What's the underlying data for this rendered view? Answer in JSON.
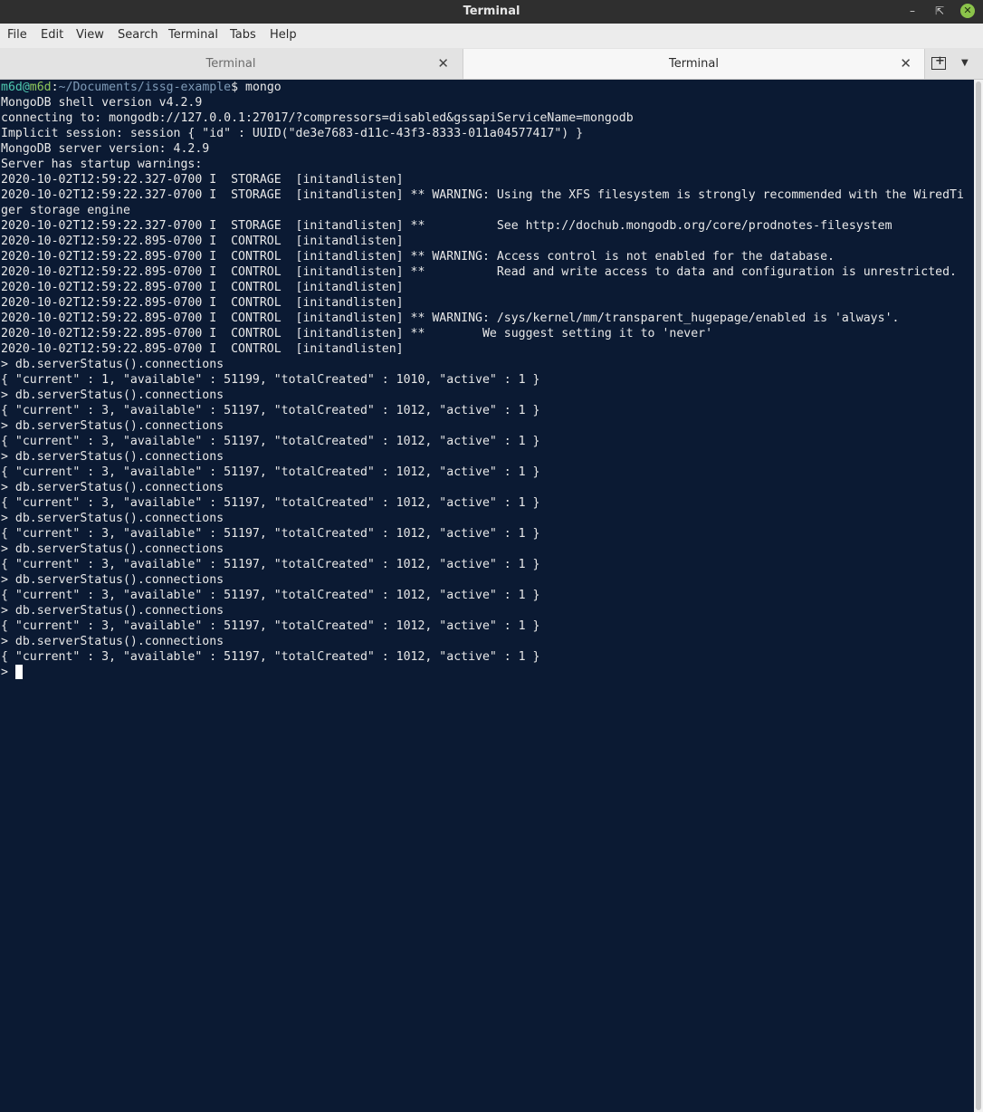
{
  "window": {
    "title": "Terminal"
  },
  "menu": [
    "File",
    "Edit",
    "View",
    "Search",
    "Terminal",
    "Tabs",
    "Help"
  ],
  "tabs": [
    {
      "label": "Terminal",
      "active": false
    },
    {
      "label": "Terminal",
      "active": true
    }
  ],
  "prompt": {
    "user": "m6d",
    "at": "@",
    "host": "m6d",
    "sep": ":",
    "path": "~/Documents/issg-example",
    "symbol": "$ ",
    "command": "mongo"
  },
  "lines": [
    "MongoDB shell version v4.2.9",
    "connecting to: mongodb://127.0.0.1:27017/?compressors=disabled&gssapiServiceName=mongodb",
    "Implicit session: session { \"id\" : UUID(\"de3e7683-d11c-43f3-8333-011a04577417\") }",
    "MongoDB server version: 4.2.9",
    "Server has startup warnings:",
    "2020-10-02T12:59:22.327-0700 I  STORAGE  [initandlisten]",
    "2020-10-02T12:59:22.327-0700 I  STORAGE  [initandlisten] ** WARNING: Using the XFS filesystem is strongly recommended with the WiredTi",
    "ger storage engine",
    "2020-10-02T12:59:22.327-0700 I  STORAGE  [initandlisten] **          See http://dochub.mongodb.org/core/prodnotes-filesystem",
    "2020-10-02T12:59:22.895-0700 I  CONTROL  [initandlisten]",
    "2020-10-02T12:59:22.895-0700 I  CONTROL  [initandlisten] ** WARNING: Access control is not enabled for the database.",
    "2020-10-02T12:59:22.895-0700 I  CONTROL  [initandlisten] **          Read and write access to data and configuration is unrestricted.",
    "2020-10-02T12:59:22.895-0700 I  CONTROL  [initandlisten]",
    "2020-10-02T12:59:22.895-0700 I  CONTROL  [initandlisten]",
    "2020-10-02T12:59:22.895-0700 I  CONTROL  [initandlisten] ** WARNING: /sys/kernel/mm/transparent_hugepage/enabled is 'always'.",
    "2020-10-02T12:59:22.895-0700 I  CONTROL  [initandlisten] **        We suggest setting it to 'never'",
    "2020-10-02T12:59:22.895-0700 I  CONTROL  [initandlisten]",
    "> db.serverStatus().connections",
    "{ \"current\" : 1, \"available\" : 51199, \"totalCreated\" : 1010, \"active\" : 1 }",
    "> db.serverStatus().connections",
    "{ \"current\" : 3, \"available\" : 51197, \"totalCreated\" : 1012, \"active\" : 1 }",
    "> db.serverStatus().connections",
    "{ \"current\" : 3, \"available\" : 51197, \"totalCreated\" : 1012, \"active\" : 1 }",
    "> db.serverStatus().connections",
    "{ \"current\" : 3, \"available\" : 51197, \"totalCreated\" : 1012, \"active\" : 1 }",
    "> db.serverStatus().connections",
    "{ \"current\" : 3, \"available\" : 51197, \"totalCreated\" : 1012, \"active\" : 1 }",
    "> db.serverStatus().connections",
    "{ \"current\" : 3, \"available\" : 51197, \"totalCreated\" : 1012, \"active\" : 1 }",
    "> db.serverStatus().connections",
    "{ \"current\" : 3, \"available\" : 51197, \"totalCreated\" : 1012, \"active\" : 1 }",
    "> db.serverStatus().connections",
    "{ \"current\" : 3, \"available\" : 51197, \"totalCreated\" : 1012, \"active\" : 1 }",
    "> db.serverStatus().connections",
    "{ \"current\" : 3, \"available\" : 51197, \"totalCreated\" : 1012, \"active\" : 1 }",
    "> db.serverStatus().connections",
    "{ \"current\" : 3, \"available\" : 51197, \"totalCreated\" : 1012, \"active\" : 1 }",
    "> "
  ],
  "colors": {
    "background": "#0b1a33",
    "text": "#e8e8e8",
    "user": "#4ec9b0",
    "host": "#8ec85b",
    "path": "#7f9bb7"
  }
}
